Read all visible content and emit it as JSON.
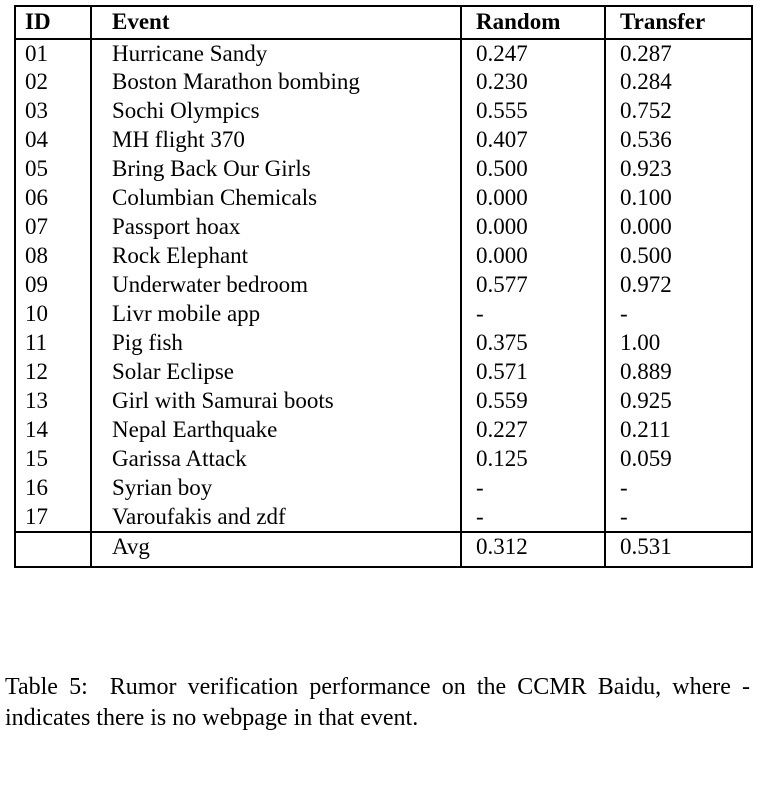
{
  "table": {
    "columns": [
      "ID",
      "Event",
      "Random",
      "Transfer"
    ],
    "rows": [
      {
        "id": "01",
        "event": "Hurricane Sandy",
        "random": "0.247",
        "transfer": "0.287",
        "random_bold": false,
        "transfer_bold": true
      },
      {
        "id": "02",
        "event": "Boston Marathon bombing",
        "random": "0.230",
        "transfer": "0.284",
        "random_bold": false,
        "transfer_bold": true
      },
      {
        "id": "03",
        "event": "Sochi Olympics",
        "random": "0.555",
        "transfer": "0.752",
        "random_bold": false,
        "transfer_bold": true
      },
      {
        "id": "04",
        "event": "MH flight 370",
        "random": "0.407",
        "transfer": "0.536",
        "random_bold": false,
        "transfer_bold": true
      },
      {
        "id": "05",
        "event": "Bring Back Our Girls",
        "random": "0.500",
        "transfer": "0.923",
        "random_bold": false,
        "transfer_bold": true
      },
      {
        "id": "06",
        "event": "Columbian Chemicals",
        "random": "0.000",
        "transfer": "0.100",
        "random_bold": false,
        "transfer_bold": true
      },
      {
        "id": "07",
        "event": "Passport hoax",
        "random": "0.000",
        "transfer": "0.000",
        "random_bold": false,
        "transfer_bold": false
      },
      {
        "id": "08",
        "event": "Rock Elephant",
        "random": "0.000",
        "transfer": "0.500",
        "random_bold": false,
        "transfer_bold": true
      },
      {
        "id": "09",
        "event": "Underwater bedroom",
        "random": "0.577",
        "transfer": "0.972",
        "random_bold": false,
        "transfer_bold": true
      },
      {
        "id": "10",
        "event": "Livr mobile app",
        "random": "-",
        "transfer": "-",
        "random_bold": false,
        "transfer_bold": false
      },
      {
        "id": "11",
        "event": "Pig fish",
        "random": "0.375",
        "transfer": "1.00",
        "random_bold": false,
        "transfer_bold": true
      },
      {
        "id": "12",
        "event": "Solar Eclipse",
        "random": "0.571",
        "transfer": "0.889",
        "random_bold": false,
        "transfer_bold": true
      },
      {
        "id": "13",
        "event": "Girl with Samurai boots",
        "random": "0.559",
        "transfer": "0.925",
        "random_bold": false,
        "transfer_bold": true
      },
      {
        "id": "14",
        "event": "Nepal Earthquake",
        "random": "0.227",
        "transfer": "0.211",
        "random_bold": true,
        "transfer_bold": false
      },
      {
        "id": "15",
        "event": "Garissa Attack",
        "random": "0.125",
        "transfer": "0.059",
        "random_bold": true,
        "transfer_bold": false
      },
      {
        "id": "16",
        "event": "Syrian boy",
        "random": "-",
        "transfer": "-",
        "random_bold": false,
        "transfer_bold": false
      },
      {
        "id": "17",
        "event": "Varoufakis and zdf",
        "random": "-",
        "transfer": "-",
        "random_bold": false,
        "transfer_bold": false
      }
    ],
    "summary": {
      "id": "",
      "event": "Avg",
      "random": "0.312",
      "transfer": "0.531",
      "random_bold": false,
      "transfer_bold": true
    }
  },
  "caption": {
    "label": "Table 5:",
    "text": "Rumor verification performance on the CCMR Baidu, where - indicates there is no webpage in that event."
  }
}
